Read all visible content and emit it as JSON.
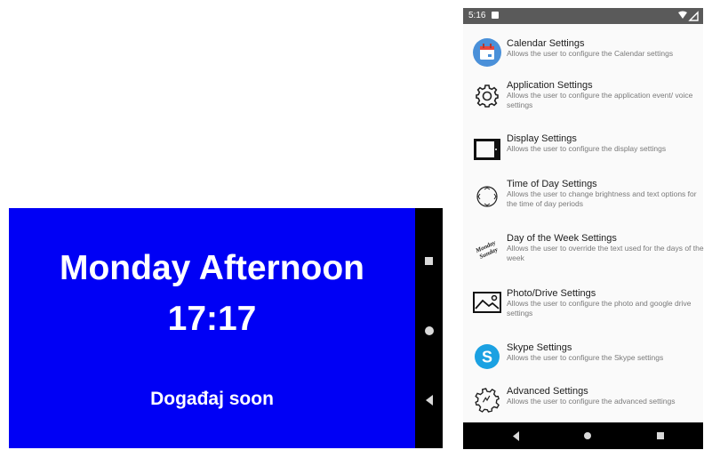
{
  "landscape": {
    "day_period": "Monday Afternoon",
    "time": "17:17",
    "event": "Događaj soon",
    "background_color": "#0000f5"
  },
  "portrait": {
    "status_time": "5:16",
    "settings": [
      {
        "title": "Calendar Settings",
        "desc": "Allows the user to configure the Calendar settings",
        "icon": "calendar-icon"
      },
      {
        "title": "Application Settings",
        "desc": "Allows the user to configure the application event/ voice settings",
        "icon": "gear-icon"
      },
      {
        "title": "Display Settings",
        "desc": "Allows the user to configure the display settings",
        "icon": "tablet-icon"
      },
      {
        "title": "Time of Day Settings",
        "desc": "Allows the user to change brightness and text options for the time of day periods",
        "icon": "clock-dial-icon"
      },
      {
        "title": "Day of the Week Settings",
        "desc": "Allows the user to override the text used for the days of the week",
        "icon": "monday-sunday-icon",
        "icon_text": [
          "Monday",
          "Sunday"
        ]
      },
      {
        "title": "Photo/Drive Settings",
        "desc": "Allows the user to configure the photo and google drive settings",
        "icon": "photo-icon"
      },
      {
        "title": "Skype Settings",
        "desc": "Allows the user to configure the Skype settings",
        "icon": "skype-icon",
        "icon_text": "S"
      },
      {
        "title": "Advanced Settings",
        "desc": "Allows the user to configure the advanced settings",
        "icon": "advanced-gear-icon"
      }
    ]
  }
}
